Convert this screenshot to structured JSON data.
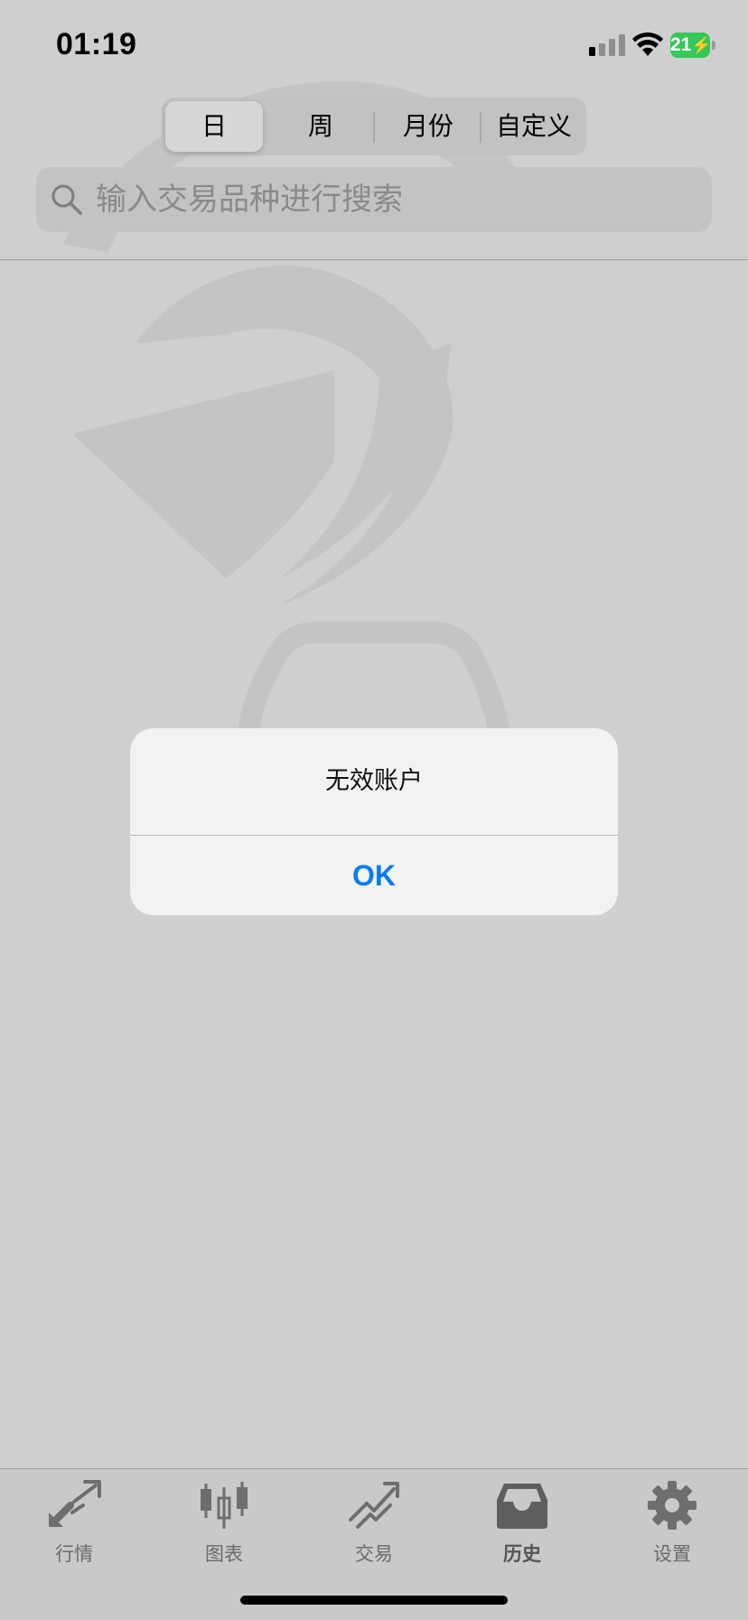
{
  "status_bar": {
    "time": "01:19",
    "battery_level": "21",
    "battery_color": "#34c759",
    "icons": [
      "signal-icon",
      "wifi-icon",
      "battery-charging-icon"
    ]
  },
  "period_selector": {
    "options": [
      {
        "label": "日",
        "selected": true
      },
      {
        "label": "周",
        "selected": false
      },
      {
        "label": "月份",
        "selected": false
      },
      {
        "label": "自定义",
        "selected": false
      }
    ]
  },
  "search": {
    "placeholder": "输入交易品种进行搜索",
    "value": "",
    "icon": "search-icon"
  },
  "alert": {
    "message": "无效账户",
    "ok_label": "OK",
    "accent_color": "#0a7cf0"
  },
  "tab_bar": {
    "tabs": [
      {
        "label": "行情",
        "icon": "quotes-arrows-icon",
        "active": false
      },
      {
        "label": "图表",
        "icon": "candlestick-chart-icon",
        "active": false
      },
      {
        "label": "交易",
        "icon": "trade-trend-icon",
        "active": false
      },
      {
        "label": "历史",
        "icon": "inbox-history-icon",
        "active": true
      },
      {
        "label": "设置",
        "icon": "gear-icon",
        "active": false
      }
    ]
  }
}
